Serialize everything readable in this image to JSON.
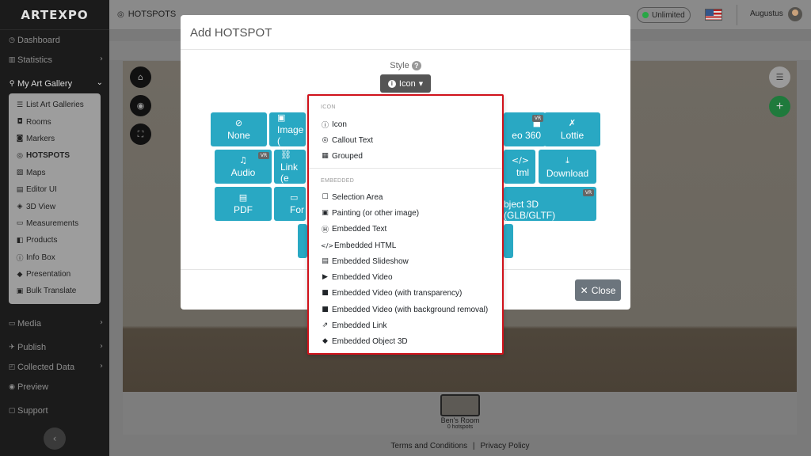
{
  "brand": "ARTEXPO",
  "sidebar": {
    "items": [
      {
        "label": "Dashboard",
        "icon": "dashboard-icon",
        "glyph": "◷"
      },
      {
        "label": "Statistics",
        "icon": "chart-icon",
        "glyph": "▥",
        "chev": "›"
      },
      {
        "label": "My Art Gallery",
        "icon": "gallery-icon",
        "glyph": "⚲",
        "chev": "⌄"
      }
    ],
    "submenu": [
      {
        "label": "List Art Galleries",
        "glyph": "☰"
      },
      {
        "label": "Rooms",
        "glyph": "◘"
      },
      {
        "label": "Markers",
        "glyph": "◙"
      },
      {
        "label": "HOTSPOTS",
        "glyph": "◎",
        "active": true
      },
      {
        "label": "Maps",
        "glyph": "▨"
      },
      {
        "label": "Editor UI",
        "glyph": "▤"
      },
      {
        "label": "3D View",
        "glyph": "◈"
      },
      {
        "label": "Measurements",
        "glyph": "▭"
      },
      {
        "label": "Products",
        "glyph": "◧"
      },
      {
        "label": "Info Box",
        "glyph": "ⓘ"
      },
      {
        "label": "Presentation",
        "glyph": "◆"
      },
      {
        "label": "Bulk Translate",
        "glyph": "▣"
      }
    ],
    "lower_items": [
      {
        "label": "Media",
        "glyph": "▭",
        "chev": "›"
      },
      {
        "label": "Publish",
        "glyph": "✈",
        "chev": "›"
      },
      {
        "label": "Collected Data",
        "glyph": "◰",
        "chev": "›"
      },
      {
        "label": "Preview",
        "glyph": "◉"
      },
      {
        "label": "Support",
        "glyph": "▢"
      }
    ],
    "collapse_glyph": "‹"
  },
  "topbar": {
    "breadcrumb": "HOTSPOTS",
    "plan": "Unlimited",
    "user": "Augustus"
  },
  "modal": {
    "title": "Add HOTSPOT",
    "style_label": "Style",
    "style_value": "Icon",
    "close_label": "Close",
    "tiles": [
      {
        "label": "None",
        "glyph": "⊘"
      },
      {
        "label": "Image (",
        "glyph": "▣"
      },
      {
        "label": "eo 360",
        "glyph": "■",
        "vr": true
      },
      {
        "label": "Lottie",
        "glyph": "✗"
      },
      {
        "label": "Audio",
        "glyph": "♫",
        "vr": true
      },
      {
        "label": "Link (e",
        "glyph": "⛓"
      },
      {
        "label": "tml",
        "glyph": "</>"
      },
      {
        "label": "Download",
        "glyph": "⤓"
      },
      {
        "label": "PDF",
        "glyph": "▤"
      },
      {
        "label": "For",
        "glyph": "▭"
      },
      {
        "label": "bject 3D (GLB/GLTF)",
        "glyph": "◆",
        "vr": true
      },
      {
        "label": "",
        "glyph": ""
      },
      {
        "label": "",
        "glyph": ""
      }
    ]
  },
  "dropdown": {
    "icon_header": "ICON",
    "icon_items": [
      {
        "label": "Icon",
        "glyph": "ⓘ"
      },
      {
        "label": "Callout Text",
        "glyph": "◎"
      },
      {
        "label": "Grouped",
        "glyph": "▦"
      }
    ],
    "embedded_header": "EMBEDDED",
    "embedded_items": [
      {
        "label": "Selection Area",
        "glyph": "☐"
      },
      {
        "label": "Painting (or other image)",
        "glyph": "▣"
      },
      {
        "label": "Embedded Text",
        "glyph": "Ⓗ"
      },
      {
        "label": "Embedded HTML",
        "glyph": "</>"
      },
      {
        "label": "Embedded Slideshow",
        "glyph": "▤"
      },
      {
        "label": "Embedded Video",
        "glyph": "▶"
      },
      {
        "label": "Embedded Video (with transparency)",
        "glyph": "■"
      },
      {
        "label": "Embedded Video (with background removal)",
        "glyph": "■"
      },
      {
        "label": "Embedded Link",
        "glyph": "⇗"
      },
      {
        "label": "Embedded Object 3D",
        "glyph": "◆"
      }
    ]
  },
  "room": {
    "name": "Ben's Room",
    "hotspots": "0 hotspots"
  },
  "footer": {
    "terms": "Terms and Conditions",
    "sep": "|",
    "privacy": "Privacy Policy"
  },
  "colors": {
    "accent": "#29a8c3",
    "highlight": "#d0121b",
    "success": "#28a745"
  }
}
